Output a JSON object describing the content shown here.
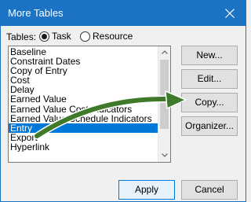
{
  "window": {
    "title": "More Tables",
    "close_icon": "close-icon"
  },
  "tables_label": "Tables:",
  "radio": {
    "task_label": "Task",
    "task_checked": true,
    "resource_label": "Resource",
    "resource_checked": false
  },
  "list": {
    "items": [
      "Baseline",
      "Constraint Dates",
      "Copy of Entry",
      "Cost",
      "Delay",
      "Earned Value",
      "Earned Value Cost Indicators",
      "Earned Value Schedule Indicators",
      "Entry",
      "Export",
      "Hyperlink"
    ],
    "selected_index": 8
  },
  "buttons": {
    "new": "New...",
    "edit": "Edit...",
    "copy": "Copy...",
    "organizer": "Organizer...",
    "apply": "Apply",
    "cancel": "Cancel"
  },
  "colors": {
    "titlebar": "#1c73c5",
    "selection": "#0078d7",
    "arrow": "#3f7a2a"
  }
}
